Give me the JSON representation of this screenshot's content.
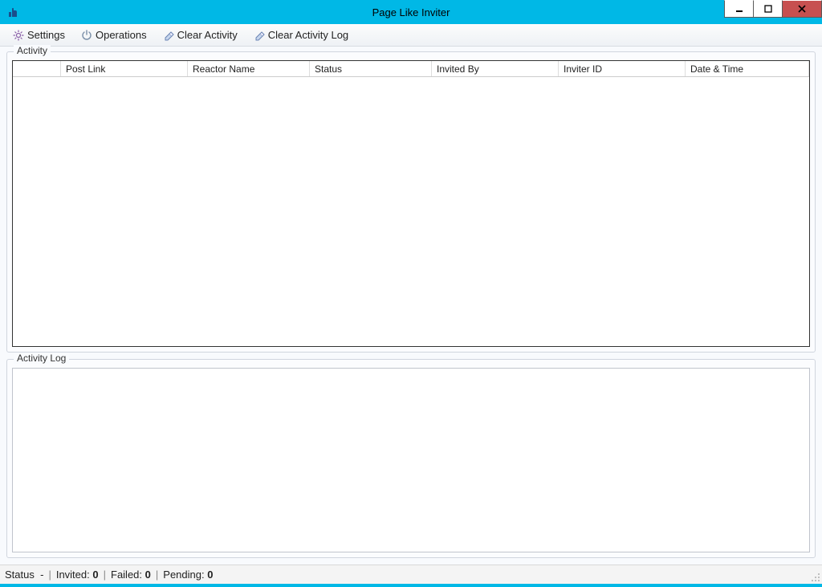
{
  "window": {
    "title": "Page Like Inviter"
  },
  "toolbar": {
    "settings": "Settings",
    "operations": "Operations",
    "clear_activity": "Clear Activity",
    "clear_activity_log": "Clear Activity Log"
  },
  "groups": {
    "activity": "Activity",
    "activity_log": "Activity Log"
  },
  "table": {
    "columns": [
      "",
      "Post Link",
      "Reactor Name",
      "Status",
      "Invited By",
      "Inviter ID",
      "Date & Time"
    ]
  },
  "statusbar": {
    "status_label": "Status",
    "status_value": "-",
    "invited_label": "Invited:",
    "invited_value": "0",
    "failed_label": "Failed:",
    "failed_value": "0",
    "pending_label": "Pending:",
    "pending_value": "0"
  }
}
